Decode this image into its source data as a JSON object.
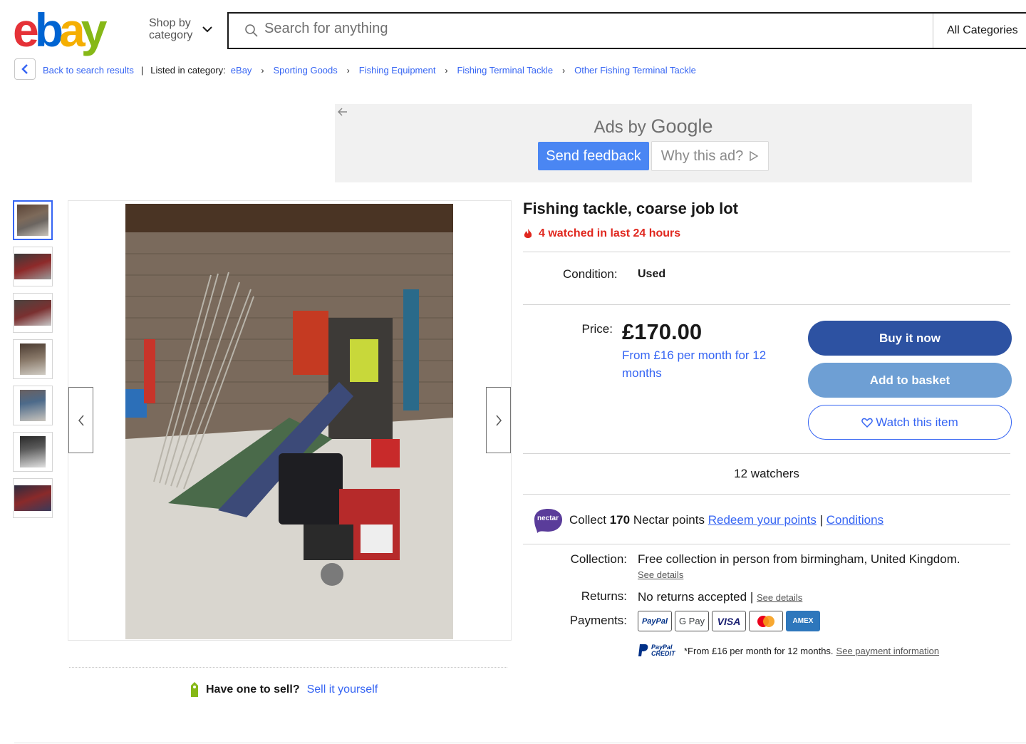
{
  "header": {
    "logo_letters": [
      "e",
      "b",
      "a",
      "y"
    ],
    "logo_colors": [
      "#e53238",
      "#0064d2",
      "#f5af02",
      "#86b817"
    ],
    "shop_by_line1": "Shop by",
    "shop_by_line2": "category",
    "search_placeholder": "Search for anything",
    "all_categories": "All Categories"
  },
  "breadcrumb": {
    "back_label": "Back to search results",
    "listed_label": "Listed in category:",
    "items": [
      "eBay",
      "Sporting Goods",
      "Fishing Equipment",
      "Fishing Terminal Tackle",
      "Other Fishing Terminal Tackle"
    ]
  },
  "ad": {
    "ads_by": "Ads by",
    "google": "Google",
    "send_feedback": "Send feedback",
    "why_this_ad": "Why this ad?"
  },
  "gallery": {
    "thumbnail_count": 7,
    "active_index": 0
  },
  "sell": {
    "question": "Have one to sell?",
    "link": "Sell it yourself"
  },
  "item": {
    "title": "Fishing tackle, coarse job lot",
    "watched_badge": "4 watched in last 24 hours",
    "condition_label": "Condition:",
    "condition_value": "Used",
    "price_label": "Price:",
    "price": "£170.00",
    "finance": "From £16 per month for 12 months",
    "buy_now": "Buy it now",
    "add_to_basket": "Add to basket",
    "watch": "Watch this item",
    "watchers": "12 watchers"
  },
  "nectar": {
    "text_prefix": "Collect",
    "points": "170",
    "text_suffix": "Nectar points",
    "redeem_link": "Redeem your points",
    "separator": "|",
    "conditions_link": "Conditions",
    "logo_text": "nectar"
  },
  "shipping": {
    "collection_label": "Collection:",
    "collection_value": "Free collection in person from birmingham, United Kingdom.",
    "collection_link": "See details",
    "returns_label": "Returns:",
    "returns_value": "No returns accepted",
    "returns_sep": "|",
    "returns_link": "See details",
    "payments_label": "Payments:",
    "payment_methods": [
      "PayPal",
      "G Pay",
      "VISA",
      "Mastercard",
      "AMEX"
    ],
    "credit_logo": "PayPal CREDIT",
    "credit_text": "*From £16 per month for 12 months.",
    "credit_link": "See payment information"
  },
  "colors": {
    "link": "#3665f3",
    "buy_now": "#2d52a2",
    "basket": "#6e9fd4",
    "watched": "#e0271e"
  }
}
